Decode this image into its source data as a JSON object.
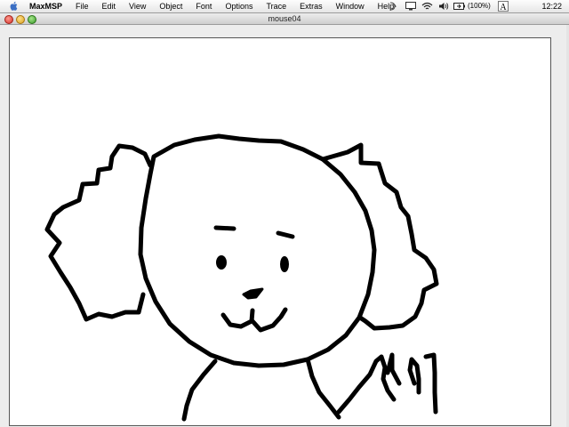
{
  "menubar": {
    "apple_icon": "apple-icon",
    "items": [
      "MaxMSP",
      "File",
      "Edit",
      "View",
      "Object",
      "Font",
      "Options",
      "Trace",
      "Extras",
      "Window",
      "Help"
    ],
    "battery_text": "(100%)",
    "clock": "12:22",
    "status_icons": [
      "script-menu-icon",
      "display-icon",
      "wifi-icon",
      "volume-icon",
      "battery-icon",
      "input-menu-icon"
    ]
  },
  "window": {
    "title": "mouse04",
    "controls": [
      "close-button",
      "minimize-button",
      "zoom-button"
    ]
  },
  "canvas": {
    "content": "drawing"
  }
}
